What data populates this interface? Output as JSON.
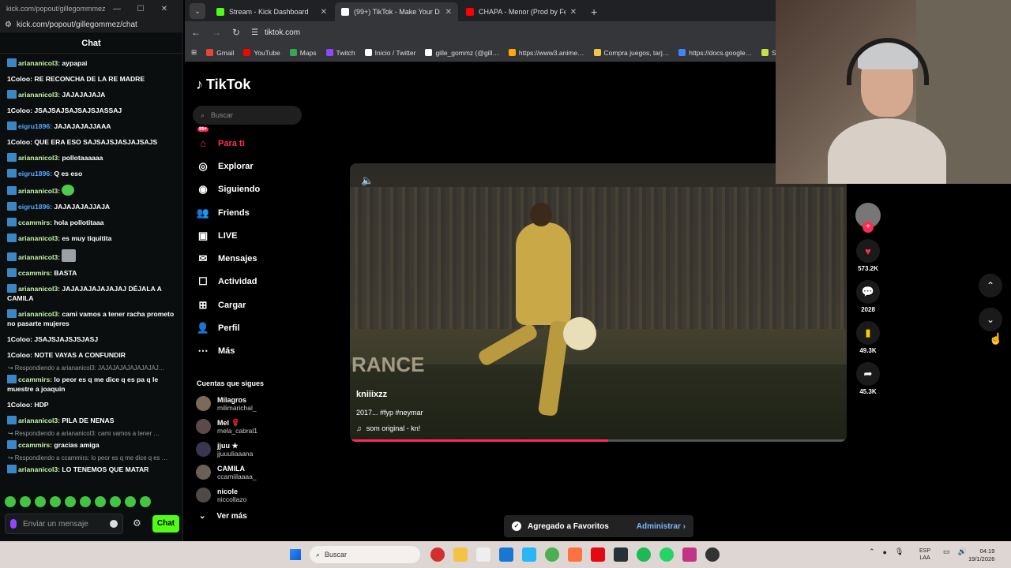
{
  "kick": {
    "window_url": "kick.com/popout/gillegommmez/…",
    "win_controls": [
      "—",
      "☐",
      "✕"
    ],
    "address": "kick.com/popout/gillegommez/chat",
    "title": "Chat",
    "messages": [
      {
        "user": "ariananicol3:",
        "text": " aypapai",
        "style": "green"
      },
      {
        "user": "1Coloo:",
        "text": " RE RECONCHA DE LA RE MADRE",
        "style": "plain"
      },
      {
        "user": "ariananicol3:",
        "text": " JAJAJAJAJA",
        "style": "green"
      },
      {
        "user": "1Coloo:",
        "text": " JSAJSAJSAJSAJSJASSAJ",
        "style": "plain"
      },
      {
        "user": "eigru1896:",
        "text": " JAJAJAJAJJAAA",
        "style": "blue2"
      },
      {
        "user": "1Coloo:",
        "text": " QUE ERA ESO SAJSAJSJASJAJSAJS",
        "style": "plain"
      },
      {
        "user": "ariananicol3:",
        "text": " pollotaaaaaa",
        "style": "green"
      },
      {
        "user": "eigru1896:",
        "text": " Q es eso",
        "style": "blue2"
      },
      {
        "user": "ariananicol3:",
        "text": " ",
        "style": "green",
        "emote": "green"
      },
      {
        "user": "eigru1896:",
        "text": " JAJAJAJAJJAJA",
        "style": "blue2"
      },
      {
        "user": "ccammirs:",
        "text": " hola pollotitaaa",
        "style": "green"
      },
      {
        "user": "ariananicol3:",
        "text": " es muy tiquitita",
        "style": "green"
      },
      {
        "user": "ariananicol3:",
        "text": " ",
        "style": "green",
        "emote": "gray"
      },
      {
        "user": "ccammirs:",
        "text": " BASTA",
        "style": "green"
      },
      {
        "user": "ariananicol3:",
        "text": " JAJAJAJAJAJAJAJ DÉJALA A CAMILA",
        "style": "green"
      },
      {
        "user": "ariananicol3:",
        "text": " cami vamos a tener racha prometo no pasarte mujeres",
        "style": "green"
      },
      {
        "user": "1Coloo:",
        "text": " JSAJSJAJSJSJASJ",
        "style": "plain"
      },
      {
        "user": "1Coloo:",
        "text": " NOTE VAYAS A CONFUNDIR",
        "style": "plain"
      },
      {
        "reply": "↪ Respondiendo a ariananicol3: JAJAJAJAJAJAJAJAJ…",
        "user": "ccammirs:",
        "text": " lo peor es q me dice q es pa q le muestre a joaquin",
        "style": "green"
      },
      {
        "user": "1Coloo:",
        "text": " HDP",
        "style": "plain"
      },
      {
        "user": "ariananicol3:",
        "text": " PILA DE NENAS",
        "style": "green"
      },
      {
        "reply": "↪ Respondiendo a ariananicol3: cami vamos a tener …",
        "user": "ccammirs:",
        "text": " gracias amiga",
        "style": "green"
      },
      {
        "reply": "↪ Respondiendo a ccammirs: lo peor es q me dice q es …",
        "user": "ariananicol3:",
        "text": " LO TENEMOS QUE MATAR",
        "style": "green"
      }
    ],
    "input_placeholder": "Enviar un mensaje",
    "settings_icon": "gear-icon",
    "send_label": "Chat"
  },
  "browser": {
    "tabs": [
      {
        "label": "Stream - Kick Dashboard",
        "color": "#53fc18",
        "active": false
      },
      {
        "label": "(99+) TikTok - Make Your D…",
        "color": "#ffffff",
        "active": true
      },
      {
        "label": "CHAPA - Menor (Prod by Feich…",
        "color": "#ff0000",
        "active": false
      }
    ],
    "url": "tiktok.com",
    "bookmarks": [
      {
        "label": "Gmail",
        "color": "#ea4335"
      },
      {
        "label": "YouTube",
        "color": "#ff0000"
      },
      {
        "label": "Maps",
        "color": "#34a853"
      },
      {
        "label": "Twitch",
        "color": "#9146ff"
      },
      {
        "label": "Inicio / Twitter",
        "color": "#ffffff"
      },
      {
        "label": "gille_gommz (@gill…",
        "color": "#ffffff"
      },
      {
        "label": "https://www3.anime…",
        "color": "#ffaa00"
      },
      {
        "label": "Compra juegos, tarj…",
        "color": "#f6c244"
      },
      {
        "label": "https://docs.google…",
        "color": "#4285f4"
      },
      {
        "label": "Spir",
        "color": "#c6e04a"
      }
    ]
  },
  "tiktok": {
    "logo": "TikTok",
    "search_placeholder": "Buscar",
    "nav": [
      {
        "label": "Para ti",
        "icon": "home-icon",
        "glyph": "⌂",
        "active": true
      },
      {
        "label": "Explorar",
        "icon": "compass-icon",
        "glyph": "◎",
        "active": false
      },
      {
        "label": "Siguiendo",
        "icon": "following-avatar-icon",
        "glyph": "◉",
        "active": false
      },
      {
        "label": "Friends",
        "icon": "friends-icon",
        "glyph": "👥",
        "active": false
      },
      {
        "label": "LIVE",
        "icon": "live-icon",
        "glyph": "▣",
        "active": false
      },
      {
        "label": "Mensajes",
        "icon": "messages-icon",
        "glyph": "✉",
        "active": false,
        "badge": "99+"
      },
      {
        "label": "Actividad",
        "icon": "activity-icon",
        "glyph": "☐",
        "active": false
      },
      {
        "label": "Cargar",
        "icon": "upload-icon",
        "glyph": "⊞",
        "active": false
      },
      {
        "label": "Perfil",
        "icon": "profile-icon",
        "glyph": "👤",
        "active": false
      },
      {
        "label": "Más",
        "icon": "more-icon",
        "glyph": "⋯",
        "active": false
      }
    ],
    "following_heading": "Cuentas que sigues",
    "following": [
      {
        "name": "Milagros",
        "handle": "milimarichal_"
      },
      {
        "name": "Mel 🌹",
        "handle": "mela_cabral1"
      },
      {
        "name": "jjuu ★",
        "handle": "jjuuuliaaana"
      },
      {
        "name": "CAMILA",
        "handle": "ccamiilaaaa_"
      },
      {
        "name": "nicole",
        "handle": "niccollazo"
      }
    ],
    "see_more": "Ver más",
    "video": {
      "board_text": "RANCE",
      "author": "kniiixzz",
      "caption": "2017... #fyp #neymar",
      "sound": "som original - kn!",
      "progress": 0.52
    },
    "actions": {
      "likes": "573.2K",
      "comments": "2028",
      "saves": "49.3K",
      "shares": "45.3K"
    },
    "toast": {
      "text": "Agregado a Favoritos",
      "action": "Administrar"
    }
  },
  "taskbar": {
    "search": "Buscar",
    "lang1": "ESP",
    "lang2": "LAA",
    "time": "04:19",
    "date": "19/1/2026"
  }
}
